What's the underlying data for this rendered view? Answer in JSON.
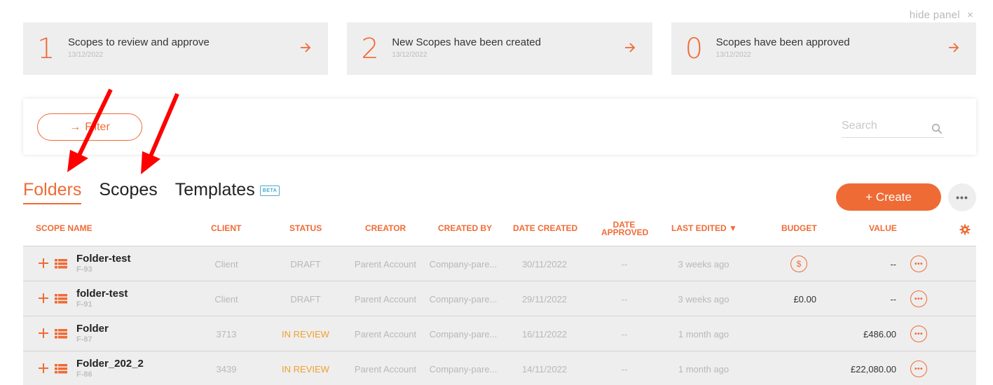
{
  "panel": {
    "hide_label": "hide panel",
    "close_glyph": "×"
  },
  "cards": [
    {
      "number": "1",
      "title": "Scopes to review and approve",
      "date": "13/12/2022"
    },
    {
      "number": "2",
      "title": "New Scopes have been created",
      "date": "13/12/2022"
    },
    {
      "number": "0",
      "title": "Scopes have been approved",
      "date": "13/12/2022"
    }
  ],
  "filter": {
    "label": "Filter",
    "arrow_glyph": "→"
  },
  "search": {
    "placeholder": "Search"
  },
  "tabs": [
    {
      "label": "Folders",
      "active": true
    },
    {
      "label": "Scopes",
      "active": false
    },
    {
      "label": "Templates",
      "active": false,
      "badge": "BETA"
    }
  ],
  "create": {
    "label": "+ Create"
  },
  "more_glyph": "•••",
  "table": {
    "headers": {
      "scope_name": "SCOPE NAME",
      "client": "CLIENT",
      "status": "STATUS",
      "creator": "CREATOR",
      "created_by": "CREATED BY",
      "date_created": "DATE CREATED",
      "date_approved_1": "DATE",
      "date_approved_2": "APPROVED",
      "last_edited": "LAST EDITED ▼",
      "budget": "BUDGET",
      "value": "VALUE"
    },
    "rows": [
      {
        "name": "Folder-test",
        "code": "F-93",
        "client": "Client",
        "status": "DRAFT",
        "creator": "Parent Account",
        "created_by": "Company-pare...",
        "date_created": "30/11/2022",
        "date_approved": "--",
        "last_edited": "3 weeks ago",
        "budget": "$",
        "budget_is_icon": true,
        "value": "--"
      },
      {
        "name": "folder-test",
        "code": "F-91",
        "client": "Client",
        "status": "DRAFT",
        "creator": "Parent Account",
        "created_by": "Company-pare...",
        "date_created": "29/11/2022",
        "date_approved": "--",
        "last_edited": "3 weeks ago",
        "budget": "£0.00",
        "budget_is_icon": false,
        "value": "--"
      },
      {
        "name": "Folder",
        "code": "F-87",
        "client": "3713",
        "status": "IN REVIEW",
        "creator": "Parent Account",
        "created_by": "Company-pare...",
        "date_created": "16/11/2022",
        "date_approved": "--",
        "last_edited": "1 month ago",
        "budget": "",
        "budget_is_icon": false,
        "value": "£486.00"
      },
      {
        "name": "Folder_202_2",
        "code": "F-86",
        "client": "3439",
        "status": "IN REVIEW",
        "creator": "Parent Account",
        "created_by": "Company-pare...",
        "date_created": "14/11/2022",
        "date_approved": "--",
        "last_edited": "1 month ago",
        "budget": "",
        "budget_is_icon": false,
        "value": "£22,080.00"
      }
    ]
  },
  "colors": {
    "accent": "#ef6b35",
    "review": "#f0a030",
    "annotation": "#ff0000"
  }
}
